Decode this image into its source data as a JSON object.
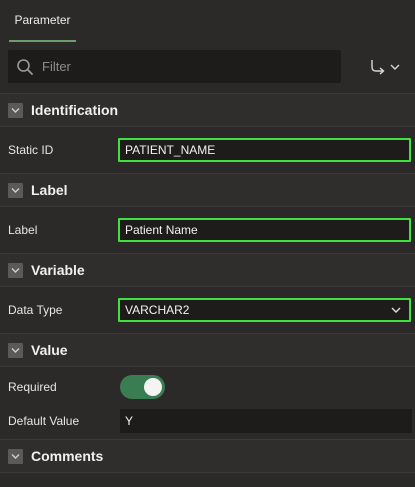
{
  "tabs": [
    {
      "label": "Parameter",
      "active": true
    }
  ],
  "toolbar": {
    "filter_placeholder": "Filter",
    "goto_icon": "goto-arrow-icon"
  },
  "sections": {
    "identification": {
      "title": "Identification",
      "static_id": {
        "label": "Static ID",
        "value": "PATIENT_NAME"
      }
    },
    "label": {
      "title": "Label",
      "label": {
        "label": "Label",
        "value": "Patient Name"
      }
    },
    "variable": {
      "title": "Variable",
      "data_type": {
        "label": "Data Type",
        "value": "VARCHAR2"
      }
    },
    "value": {
      "title": "Value",
      "required": {
        "label": "Required",
        "on": true
      },
      "default_value": {
        "label": "Default Value",
        "value": "Y"
      }
    },
    "comments": {
      "title": "Comments"
    }
  },
  "colors": {
    "background": "#2b2a28",
    "field_bg": "#1d1c1a",
    "highlight_border": "#3fe33f",
    "toggle_on": "#3a7d52",
    "tab_underline": "#6e9e6c"
  }
}
